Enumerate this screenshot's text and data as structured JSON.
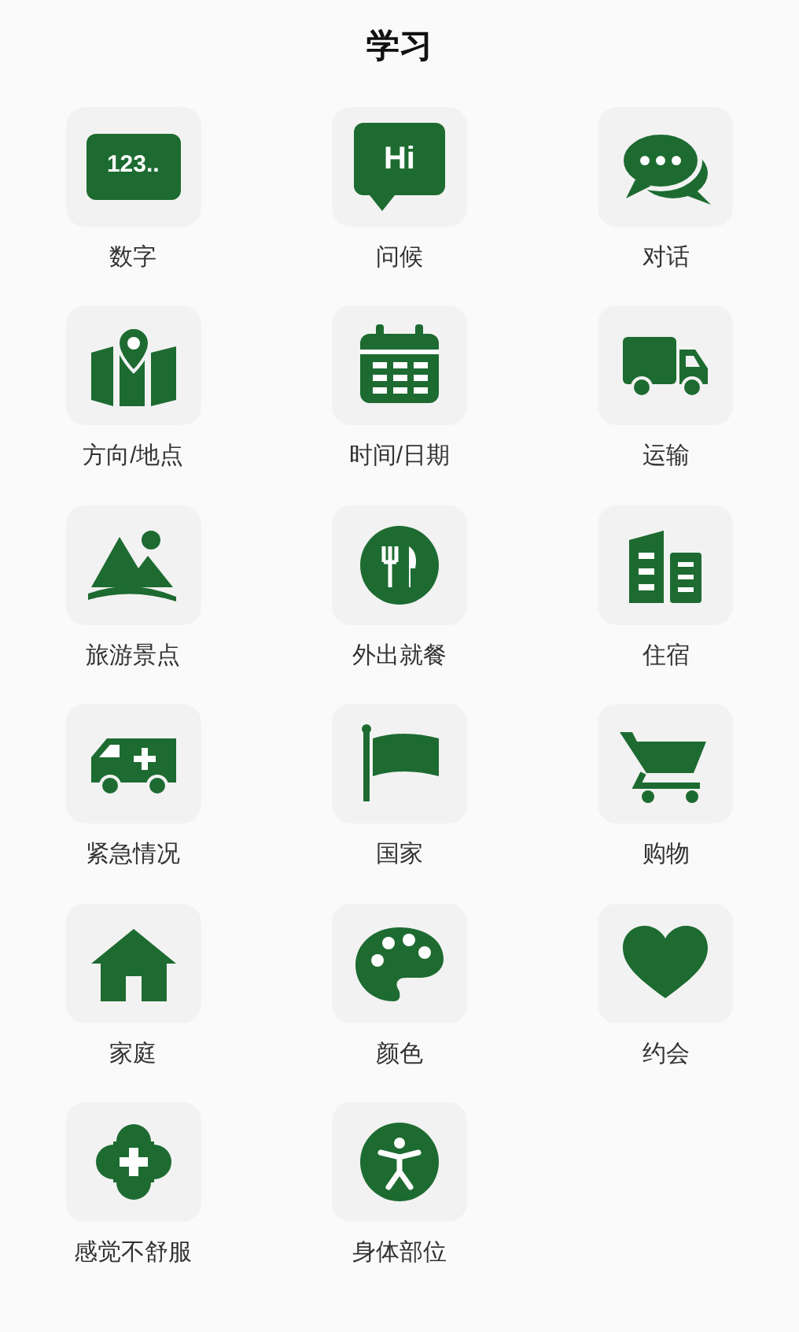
{
  "title": "学习",
  "categories": [
    {
      "label": "数字",
      "kind": "digits",
      "icon_text": "123.."
    },
    {
      "label": "问候",
      "kind": "greeting",
      "icon_text": "Hi"
    },
    {
      "label": "对话",
      "kind": "chat"
    },
    {
      "label": "方向/地点",
      "kind": "map"
    },
    {
      "label": "时间/日期",
      "kind": "calendar"
    },
    {
      "label": "运输",
      "kind": "truck"
    },
    {
      "label": "旅游景点",
      "kind": "mountain"
    },
    {
      "label": "外出就餐",
      "kind": "dining"
    },
    {
      "label": "住宿",
      "kind": "building"
    },
    {
      "label": "紧急情况",
      "kind": "ambulance"
    },
    {
      "label": "国家",
      "kind": "flag"
    },
    {
      "label": "购物",
      "kind": "cart"
    },
    {
      "label": "家庭",
      "kind": "house"
    },
    {
      "label": "颜色",
      "kind": "palette"
    },
    {
      "label": "约会",
      "kind": "heart"
    },
    {
      "label": "感觉不舒服",
      "kind": "medical"
    },
    {
      "label": "身体部位",
      "kind": "body"
    }
  ]
}
